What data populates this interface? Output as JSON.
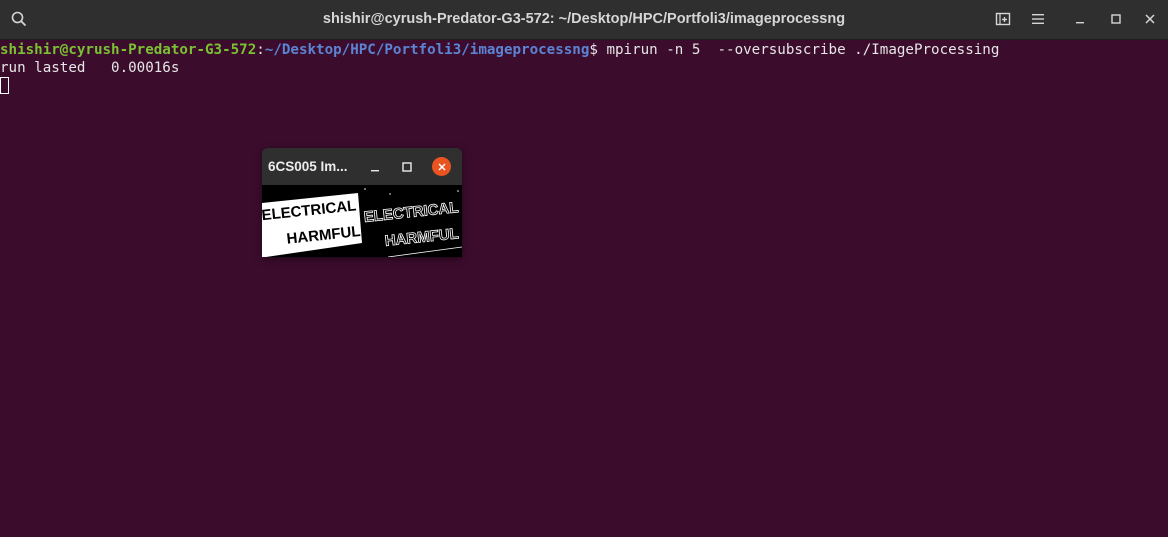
{
  "window": {
    "title": "shishir@cyrush-Predator-G3-572: ~/Desktop/HPC/Portfoli3/imageprocessng",
    "buttons": [
      "search-icon",
      "new-tab-icon",
      "menu-icon",
      "minimize-icon",
      "maximize-icon",
      "close-icon"
    ]
  },
  "terminal": {
    "prompt_user": "shishir@cyrush-Predator-G3-572",
    "prompt_sep": ":",
    "prompt_path": "~/Desktop/HPC/Portfoli3/imageprocessng",
    "prompt_dollar": "$",
    "command": " mpirun -n 5  --oversubscribe ./ImageProcessing",
    "output_line": "run lasted   0.00016s"
  },
  "image_window": {
    "title": "6CS005 Im...",
    "left_text_1": "ELECTRICAL",
    "left_text_2": "HARMFUL",
    "right_text_1": "ELECTRICAL",
    "right_text_2": "HARMFUL"
  },
  "colors": {
    "terminal_bg": "#3c0c2d",
    "titlebar_bg": "#2f2f2f",
    "prompt_user": "#7ac133",
    "prompt_path": "#5b84d4",
    "close_button": "#e95420"
  }
}
